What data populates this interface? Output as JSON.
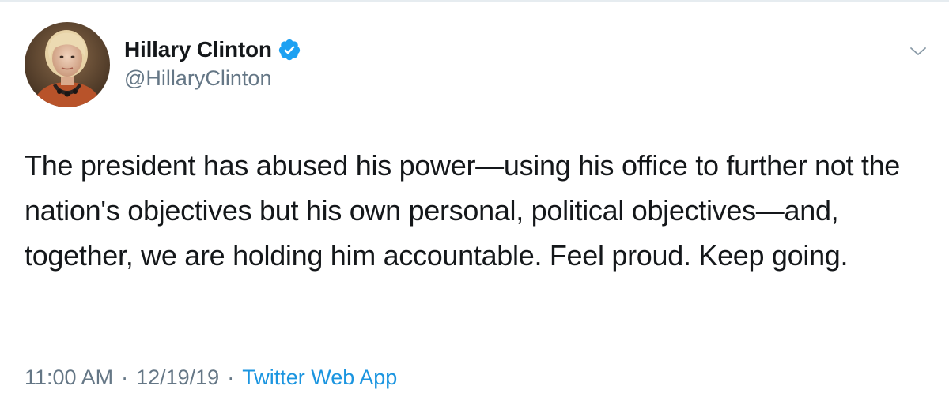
{
  "tweet": {
    "author": {
      "display_name": "Hillary Clinton",
      "handle": "@HillaryClinton",
      "verified": true,
      "avatar_icon": "profile-photo"
    },
    "text": "The president has abused his power—using his office to further not the nation's objectives but his own personal, political objectives—and, together, we are holding him accountable. Feel proud. Keep going.",
    "time": "11:00 AM",
    "date": "12/19/19",
    "separator": "·",
    "source": "Twitter Web App",
    "menu_icon": "chevron-down-icon"
  },
  "colors": {
    "text": "#14171a",
    "secondary": "#657786",
    "link": "#1b95e0",
    "verified_badge": "#1da1f2"
  }
}
